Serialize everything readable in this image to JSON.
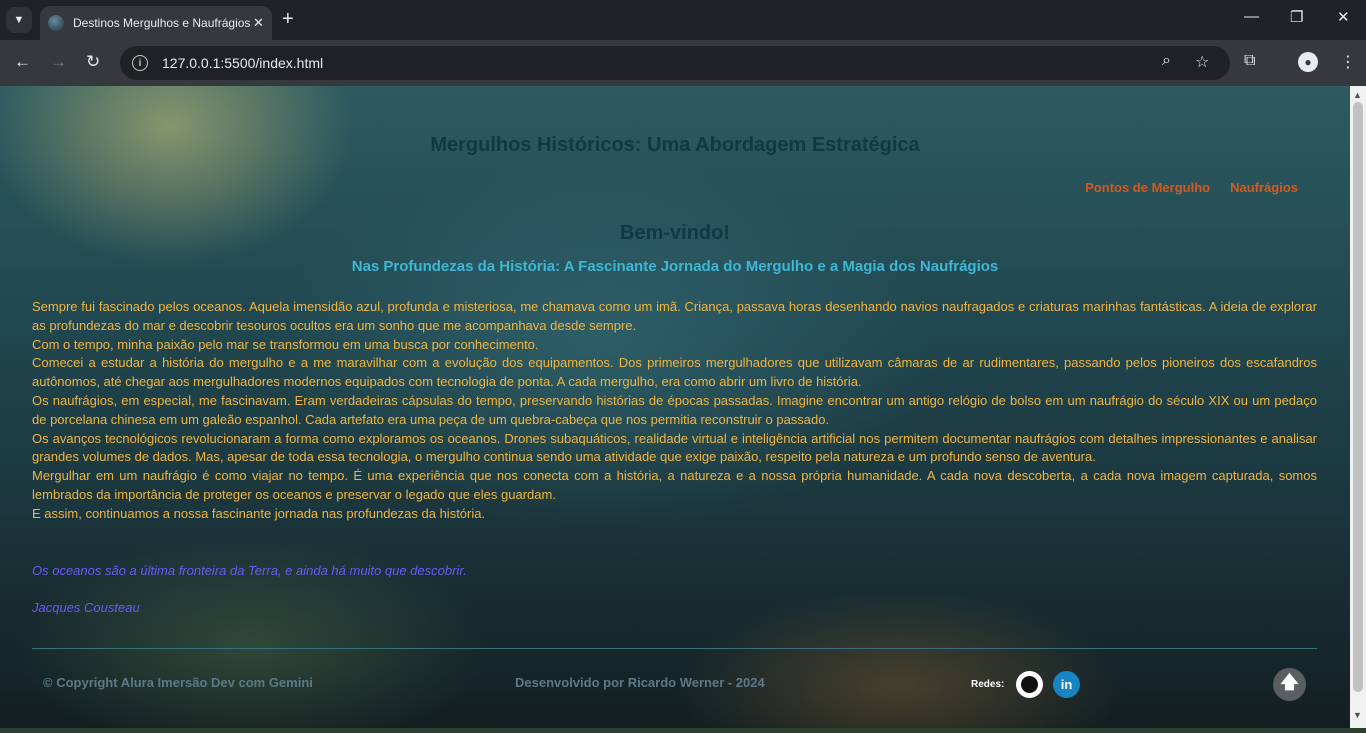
{
  "browser": {
    "tab_title": "Destinos Mergulhos e Naufrágios",
    "url": "127.0.0.1:5500/index.html",
    "tab_close": "✕",
    "new_tab": "+"
  },
  "page": {
    "title": "Mergulhos Históricos: Uma Abordagem Estratégica",
    "nav": [
      "Pontos de Mergulho",
      "Naufrágios"
    ],
    "welcome": "Bem-vindo!",
    "subtitle": "Nas Profundezas da História: A Fascinante Jornada do Mergulho e a Magia dos Naufrágios",
    "paragraphs": [
      "Sempre fui fascinado pelos oceanos. Aquela imensidão azul, profunda e misteriosa, me chamava como um imã. Criança, passava horas desenhando navios naufragados e criaturas marinhas fantásticas. A ideia de explorar as profundezas do mar e descobrir tesouros ocultos era um sonho que me acompanhava desde sempre.",
      "Com o tempo, minha paixão pelo mar se transformou em uma busca por conhecimento.",
      "Comecei a estudar a história do mergulho e a me maravilhar com a evolução dos equipamentos. Dos primeiros mergulhadores que utilizavam câmaras de ar rudimentares, passando pelos pioneiros dos escafandros autônomos, até chegar aos mergulhadores modernos equipados com tecnologia de ponta. A cada mergulho, era como abrir um livro de história.",
      "Os naufrágios, em especial, me fascinavam. Eram verdadeiras cápsulas do tempo, preservando histórias de épocas passadas. Imagine encontrar um antigo relógio de bolso em um naufrágio do século XIX ou um pedaço de porcelana chinesa em um galeão espanhol. Cada artefato era uma peça de um quebra-cabeça que nos permitia reconstruir o passado.",
      "Os avanços tecnológicos revolucionaram a forma como exploramos os oceanos. Drones subaquáticos, realidade virtual e inteligência artificial nos permitem documentar naufrágios com detalhes impressionantes e analisar grandes volumes de dados. Mas, apesar de toda essa tecnologia, o mergulho continua sendo uma atividade que exige paixão, respeito pela natureza e um profundo senso de aventura.",
      "Mergulhar em um naufrágio é como viajar no tempo. É uma experiência que nos conecta com a história, a natureza e a nossa própria humanidade. A cada nova descoberta, a cada nova imagem capturada, somos lembrados da importância de proteger os oceanos e preservar o legado que eles guardam.",
      "E assim, continuamos a nossa fascinante jornada nas profundezas da história."
    ],
    "quote": "Os oceanos são a última fronteira da Terra, e ainda há muito que descobrir.",
    "quote_author": "Jacques Cousteau"
  },
  "footer": {
    "copyright": "© Copyright Alura Imersão Dev com Gemini",
    "developer": "Desenvolvido por Ricardo Werner - 2024",
    "social_label": "Redes:",
    "linkedin_text": "in",
    "back_to_top": "🡅"
  },
  "icons": [
    "search-icon",
    "star-icon",
    "extensions-icon",
    "profile-icon",
    "more-icon",
    "github-icon",
    "linkedin-icon",
    "arrow-up-icon"
  ],
  "colors": {
    "title": "#0d3a45",
    "nav_link": "#d45a1f",
    "subtitle": "#3fb7d4",
    "body_text": "#f0b540",
    "quote": "#6d5af2",
    "footer_text": "#5b7a85"
  }
}
